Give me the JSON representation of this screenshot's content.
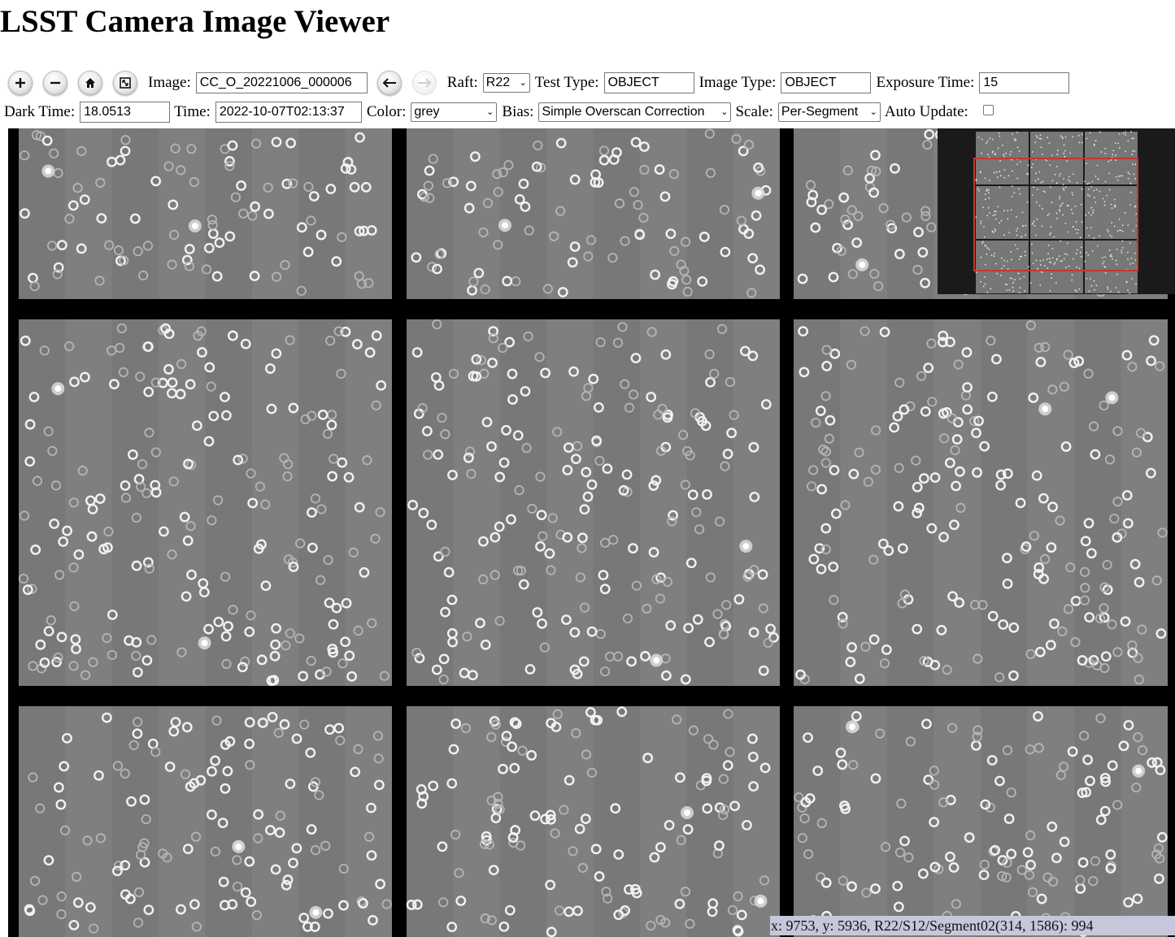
{
  "page_title": "LSST Camera Image Viewer",
  "toolbar": {
    "zoom_in_icon": "plus-icon",
    "zoom_out_icon": "minus-icon",
    "home_icon": "home-icon",
    "fullscreen_icon": "fullscreen-icon",
    "image_label": "Image:",
    "image_value": "CC_O_20221006_000006",
    "prev_icon": "arrow-left-icon",
    "next_icon": "arrow-right-icon",
    "raft_label": "Raft:",
    "raft_value": "R22",
    "test_type_label": "Test Type:",
    "test_type_value": "OBJECT",
    "image_type_label": "Image Type:",
    "image_type_value": "OBJECT",
    "exposure_label": "Exposure Time:",
    "exposure_value": "15",
    "dark_time_label": "Dark Time:",
    "dark_time_value": "18.0513",
    "time_label": "Time:",
    "time_value": "2022-10-07T02:13:37",
    "color_label": "Color:",
    "color_value": "grey",
    "bias_label": "Bias:",
    "bias_value": "Simple Overscan Correction",
    "scale_label": "Scale:",
    "scale_value": "Per-Segment",
    "auto_update_label": "Auto Update:",
    "auto_update_checked": false
  },
  "viewer": {
    "sensor_grid": {
      "rows": 3,
      "cols": 3
    },
    "background_color": "#000000",
    "sensor_color": "#7b7b7b",
    "overview_highlight_color": "#c0392b"
  },
  "status_bar": {
    "text": "x: 9753, y: 5936, R22/S12/Segment02(314, 1586): 994"
  }
}
